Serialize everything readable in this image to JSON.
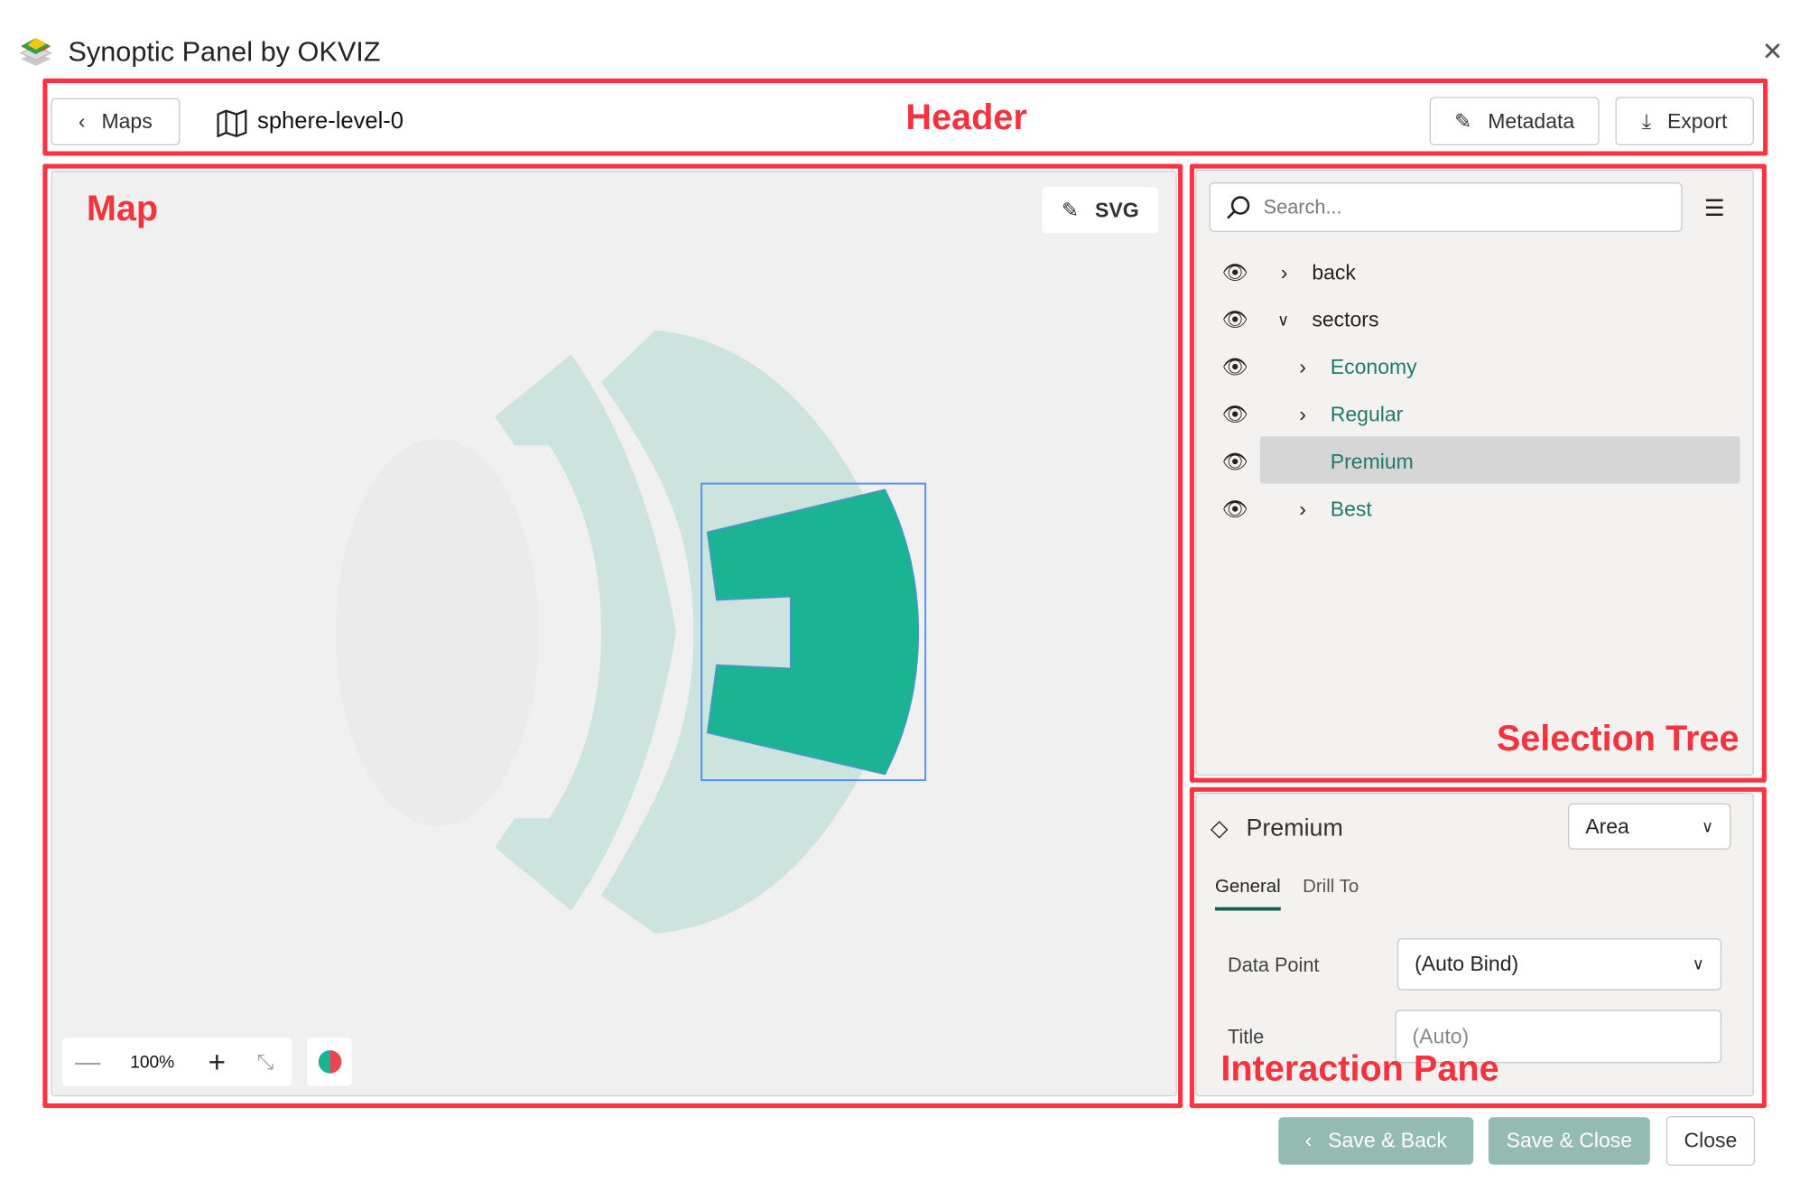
{
  "window": {
    "title": "Synoptic Panel by OKVIZ",
    "icon": "layers-logo-icon",
    "close_icon": "close-icon"
  },
  "annotations": {
    "header": "Header",
    "map": "Map",
    "selection_tree": "Selection Tree",
    "interaction_pane": "Interaction Pane"
  },
  "header": {
    "back_label": "Maps",
    "map_name": "sphere-level-0",
    "metadata_label": "Metadata",
    "export_label": "Export"
  },
  "map": {
    "svg_button": "SVG",
    "zoom": "100%",
    "colors": {
      "selected": "#1ab394",
      "area": "#cde3dd",
      "selection_border": "#4f8fff"
    }
  },
  "tree": {
    "search_placeholder": "Search...",
    "items": [
      {
        "label": "back",
        "expanded": false,
        "level": 0
      },
      {
        "label": "sectors",
        "expanded": true,
        "level": 0
      },
      {
        "label": "Economy",
        "expanded": false,
        "level": 1
      },
      {
        "label": "Regular",
        "expanded": false,
        "level": 1
      },
      {
        "label": "Premium",
        "selected": true,
        "level": 1
      },
      {
        "label": "Best",
        "expanded": false,
        "level": 1
      }
    ]
  },
  "interaction": {
    "name": "Premium",
    "type_value": "Area",
    "tabs": [
      "General",
      "Drill To"
    ],
    "active_tab": "General",
    "data_point_label": "Data Point",
    "data_point_value": "(Auto Bind)",
    "title_label": "Title",
    "title_placeholder": "(Auto)"
  },
  "footer": {
    "save_back": "Save & Back",
    "save_close": "Save & Close",
    "close": "Close",
    "accent": "#93bbb1"
  }
}
